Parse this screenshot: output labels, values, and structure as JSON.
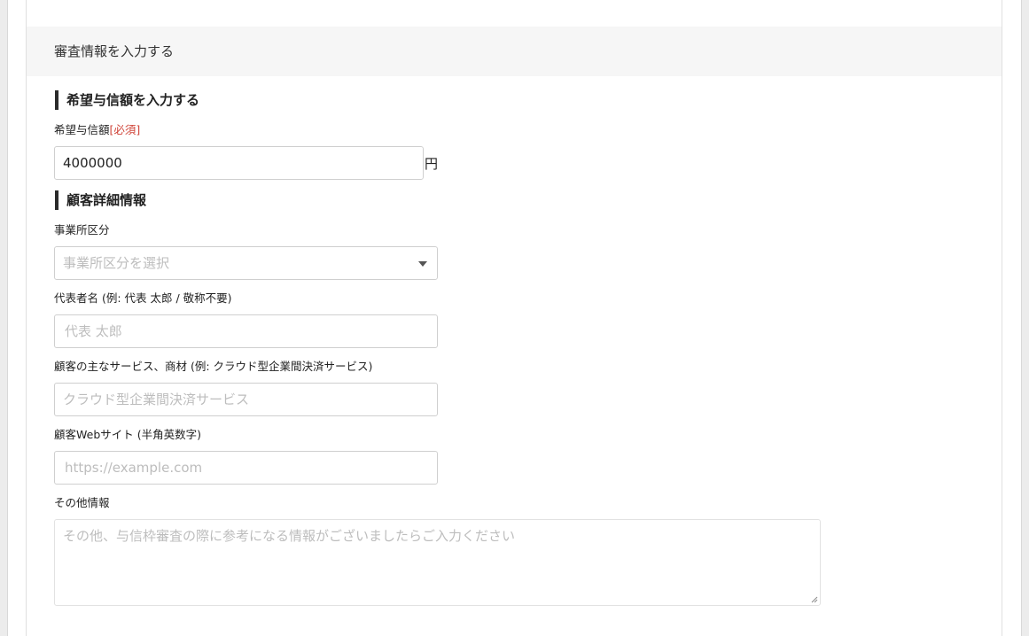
{
  "section": {
    "title": "審査情報を入力する"
  },
  "credit": {
    "heading": "希望与信額を入力する",
    "label": "希望与信額",
    "required": "[必須]",
    "value": "4000000",
    "unit": "円"
  },
  "customer": {
    "heading": "顧客詳細情報",
    "office_type": {
      "label": "事業所区分",
      "placeholder": "事業所区分を選択"
    },
    "representative": {
      "label": "代表者名 (例: 代表 太郎 / 敬称不要)",
      "placeholder": "代表 太郎"
    },
    "service": {
      "label": "顧客の主なサービス、商材 (例: クラウド型企業間決済サービス)",
      "placeholder": "クラウド型企業間決済サービス"
    },
    "website": {
      "label": "顧客Webサイト (半角英数字)",
      "placeholder": "https://example.com"
    },
    "other": {
      "label": "その他情報",
      "placeholder": "その他、与信枠審査の際に参考になる情報がございましたらご入力ください"
    }
  }
}
